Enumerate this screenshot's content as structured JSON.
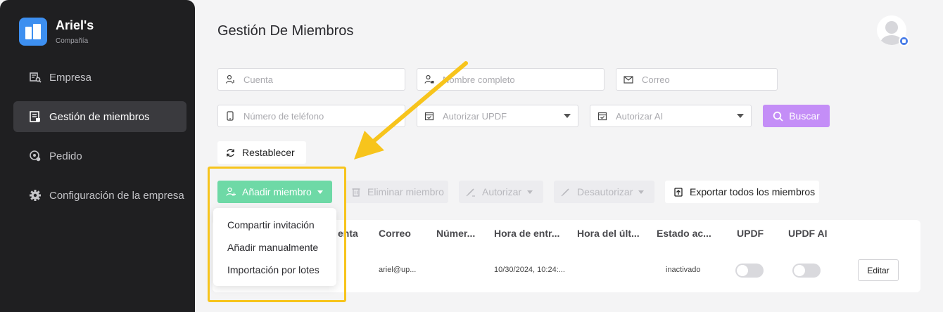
{
  "brand": {
    "name": "Ariel's",
    "subtitle": "Compañía"
  },
  "sidebar": {
    "items": [
      {
        "label": "Empresa",
        "icon": "building-search-icon",
        "active": false
      },
      {
        "label": "Gestión de miembros",
        "icon": "members-icon",
        "active": true
      },
      {
        "label": "Pedido",
        "icon": "order-icon",
        "active": false
      },
      {
        "label": "Configuración de la empresa",
        "icon": "gear-icon",
        "active": false
      }
    ]
  },
  "header": {
    "title": "Gestión De Miembros"
  },
  "filters": {
    "cuenta": {
      "placeholder": "Cuenta"
    },
    "nombre": {
      "placeholder": "Nombre completo"
    },
    "correo": {
      "placeholder": "Correo"
    },
    "telefono": {
      "placeholder": "Número de teléfono"
    },
    "autorizar_updf": {
      "placeholder": "Autorizar UPDF"
    },
    "autorizar_ai": {
      "placeholder": "Autorizar AI"
    },
    "search_label": "Buscar",
    "reset_label": "Restablecer"
  },
  "toolbar": {
    "add_label": "Añadir miembro",
    "delete_label": "Eliminar miembro",
    "authorize_label": "Autorizar",
    "deauthorize_label": "Desautorizar",
    "export_label": "Exportar todos los miembros"
  },
  "dropdown": {
    "items": [
      "Compartir invitación",
      "Añadir manualmente",
      "Importación por lotes"
    ]
  },
  "table": {
    "columns": [
      "enta",
      "Correo",
      "Númer...",
      "Hora de entr...",
      "Hora del últ...",
      "Estado ac...",
      "UPDF",
      "UPDF AI"
    ],
    "rows": [
      {
        "correo": "ariel@up...",
        "hora_entrada": "10/30/2024, 10:24:...",
        "estado": "inactivado",
        "updf": false,
        "updf_ai": false,
        "edit_label": "Editar"
      }
    ]
  },
  "colors": {
    "accent": "#c48ef7",
    "add_button": "#6ed9a6",
    "highlight": "#f7c41c",
    "sidebar": "#1f1f21"
  }
}
